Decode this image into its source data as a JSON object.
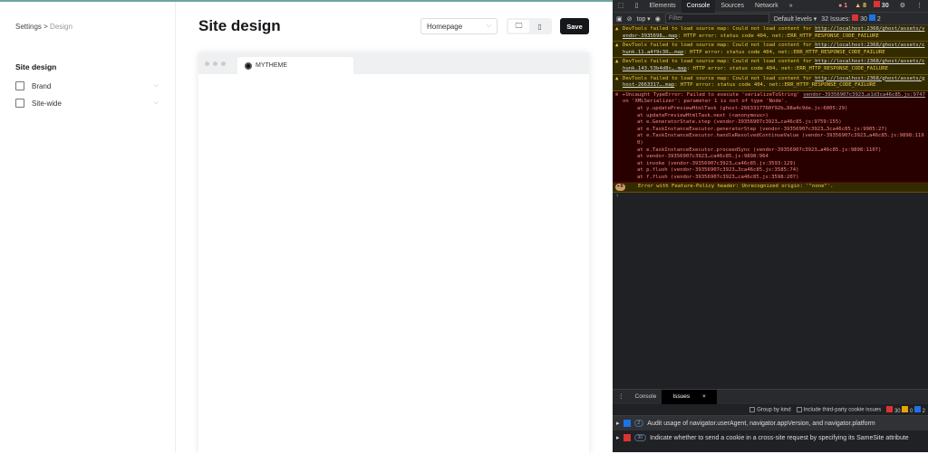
{
  "breadcrumb": {
    "parent": "Settings",
    "separator": ">",
    "current": "Design"
  },
  "sidebar": {
    "title": "Site design",
    "items": [
      {
        "label": "Brand"
      },
      {
        "label": "Site-wide"
      }
    ]
  },
  "page": {
    "title": "Site design",
    "select_value": "Homepage",
    "save_label": "Save"
  },
  "preview": {
    "tab_label": "MYTHEME"
  },
  "devtools": {
    "tabs": [
      "Elements",
      "Console",
      "Sources",
      "Network",
      "»"
    ],
    "counts": {
      "errors": "1",
      "warnings": "8",
      "issues": "30"
    },
    "context": "top ▾",
    "filter_placeholder": "Filter",
    "levels": "Default levels ▾",
    "issues_summary": "32 Issues:",
    "issues_red": "30",
    "issues_blue": "2",
    "warnings": [
      {
        "text": "DevTools failed to load source map: Could not load content for ",
        "link": "http://localhost:2368/ghost/assets/vendor-3935698….map",
        "rest": ": HTTP error: status code 404, net::ERR_HTTP_RESPONSE_CODE_FAILURE"
      },
      {
        "text": "DevTools failed to load source map: Could not load content for ",
        "link": "http://localhost:2368/ghost/assets/chunk.11.a4f9c30….map",
        "rest": ": HTTP error: status code 404, net::ERR_HTTP_RESPONSE_CODE_FAILURE"
      },
      {
        "text": "DevTools failed to load source map: Could not load content for ",
        "link": "http://localhost:2368/ghost/assets/chunk.143.53b4d8c….map",
        "rest": ": HTTP error: status code 404, net::ERR_HTTP_RESPONSE_CODE_FAILURE"
      },
      {
        "text": "DevTools failed to load source map: Could not load content for ",
        "link": "http://localhost:2368/ghost/assets/ghost-2663317….map",
        "rest": ": HTTP error: status code 404, net::ERR_HTTP_RESPONSE_CODE_FAILURE"
      }
    ],
    "error": {
      "source": "vendor-39356907c3923…e1d3ca46c85.js:9747",
      "head": "▸Uncaught TypeError: Failed to execute 'serializeToString' on 'XMLSerializer': parameter 1 is not of type 'Node'.",
      "stack": [
        "at y.updatePreviewHtmlTask (ghost-2663317760f92b…98a4c9de.js:6005:29)",
        "at updatePreviewHtmlTask.next (<anonymous>)",
        "at e.GeneratorState.step (vendor-39356907c3923…ca46c85.js:9759:155)",
        "at e.TaskInstanceExecutor.generatorStep (vendor-39356907c3923…3ca46c85.js:9905:27)",
        "at e.TaskInstanceExecutor.handleResolvedContinueValue (vendor-39356907c3923…a46c85.js:9898:1190)",
        "at e.TaskInstanceExecutor.proceedSync (vendor-39356907c3923…a46c85.js:9898:1107)",
        "at vendor-39356907c3923…ca46c85.js:9898:964",
        "at invoke (vendor-39356907c3923…ca46c85.js:3593:129)",
        "at p.flush (vendor-39356907c3923…3ca46c85.js:3585:74)",
        "at f.flush (vendor-39356907c3923…ca46c85.js:3598:207)"
      ]
    },
    "policy": "Error with Feature-Policy header: Unrecognized origin: '\"none\"'.",
    "drawer": {
      "tabs": [
        "Console",
        "Issues"
      ],
      "group_by_kind": "Group by kind",
      "third_party": "Include third-party cookie issues",
      "red": "30",
      "yellow": "0",
      "blue": "2",
      "issues": [
        {
          "count": "2",
          "text": "Audit usage of navigator.userAgent, navigator.appVersion, and navigator.platform"
        },
        {
          "count": "30",
          "text": "Indicate whether to send a cookie in a cross-site request by specifying its SameSite attribute"
        }
      ]
    }
  }
}
